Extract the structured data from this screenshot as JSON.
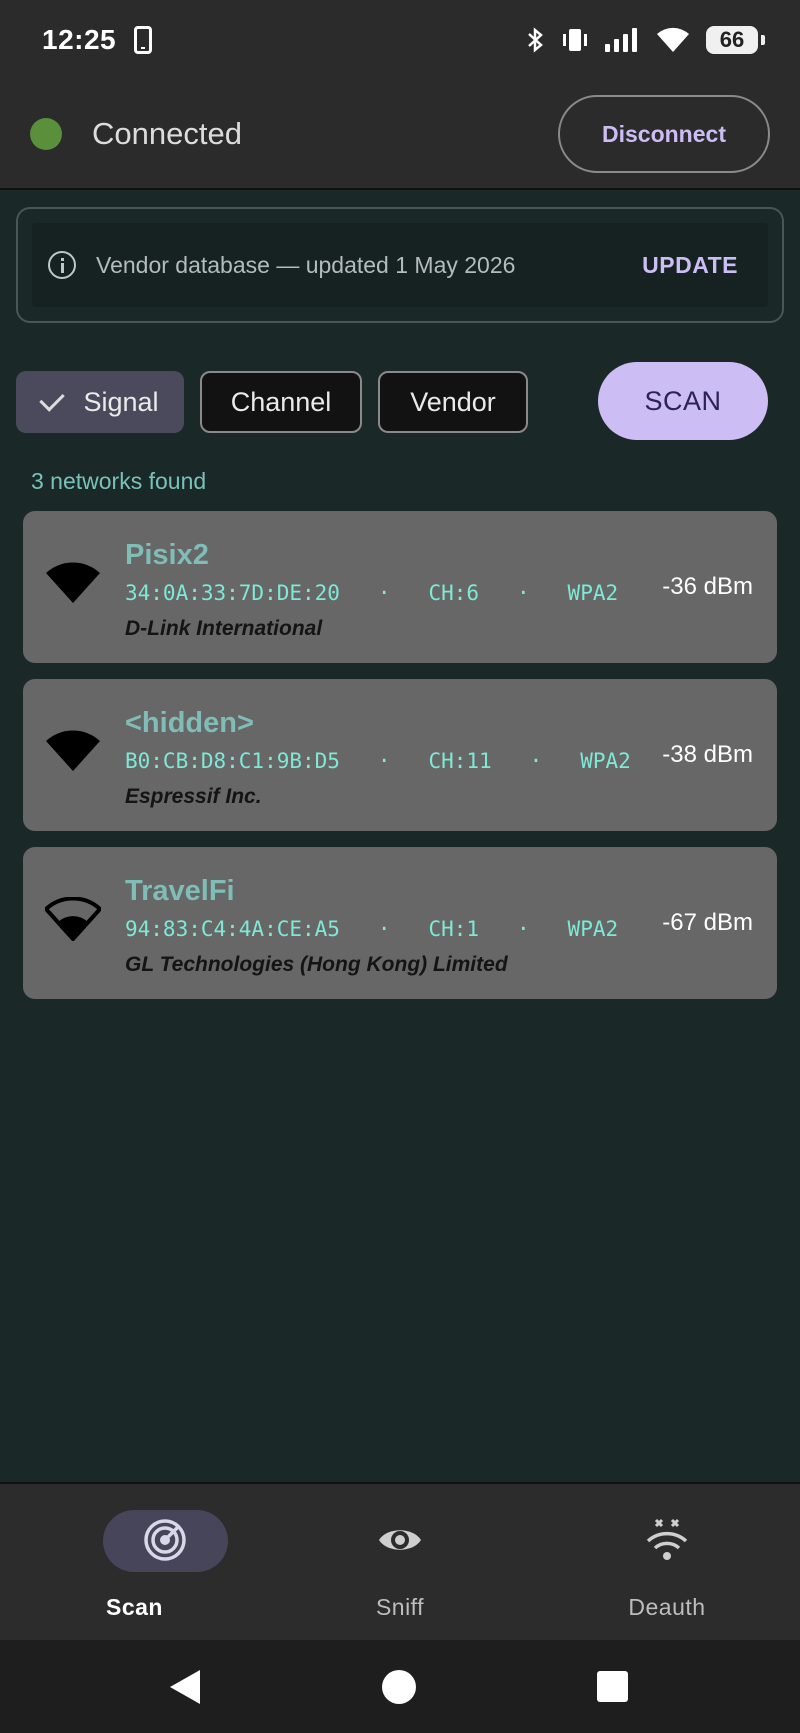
{
  "status_bar": {
    "time": "12:25",
    "battery": "66",
    "icons": [
      "phone-icon",
      "bluetooth-icon",
      "vibrate-icon",
      "cell-signal-icon",
      "wifi-icon",
      "battery-icon"
    ]
  },
  "connection": {
    "status_label": "Connected",
    "status_color": "#5a8f3c",
    "disconnect_label": "Disconnect"
  },
  "vendor_db": {
    "text": "Vendor database — updated 1 May 2026",
    "update_label": "UPDATE"
  },
  "filters": {
    "items": [
      {
        "label": "Signal",
        "selected": true
      },
      {
        "label": "Channel",
        "selected": false
      },
      {
        "label": "Vendor",
        "selected": false
      }
    ],
    "scan_label": "SCAN"
  },
  "networks": {
    "count_label": "3 networks found",
    "items": [
      {
        "ssid": "Pisix2",
        "bssid": "34:0A:33:7D:DE:20",
        "channel": "CH:6",
        "security": "WPA2",
        "vendor": "D-Link International",
        "rssi": "-36 dBm",
        "signal_icon": "wifi-full-icon"
      },
      {
        "ssid": "<hidden>",
        "bssid": "B0:CB:D8:C1:9B:D5",
        "channel": "CH:11",
        "security": "WPA2",
        "vendor": "Espressif Inc.",
        "rssi": "-38 dBm",
        "signal_icon": "wifi-full-icon"
      },
      {
        "ssid": "TravelFi",
        "bssid": "94:83:C4:4A:CE:A5",
        "channel": "CH:1",
        "security": "WPA2",
        "vendor": "GL Technologies (Hong Kong) Limited",
        "rssi": "-67 dBm",
        "signal_icon": "wifi-medium-icon"
      }
    ]
  },
  "bottom_nav": {
    "items": [
      {
        "label": "Scan",
        "icon": "radar-icon",
        "active": true
      },
      {
        "label": "Sniff",
        "icon": "eye-icon",
        "active": false
      },
      {
        "label": "Deauth",
        "icon": "wifi-off-icon",
        "active": false
      }
    ]
  },
  "colors": {
    "background": "#1b2828",
    "accent": "#cdbdf5",
    "ssid": "#7fbdb6",
    "meta": "#7fe8d6",
    "card": "#676767"
  }
}
